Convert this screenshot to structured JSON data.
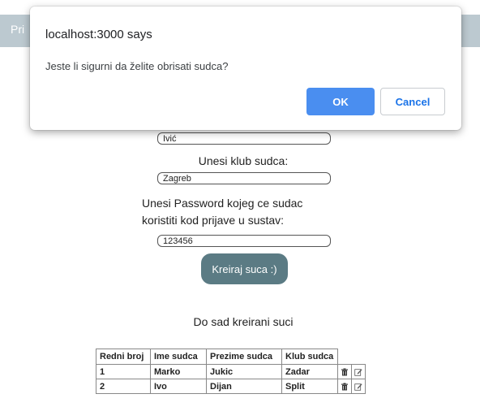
{
  "topbar": {
    "text": "Pri"
  },
  "form": {
    "surname_value": "Ivić",
    "club_label": "Unesi klub sudca:",
    "club_value": "Zagreb",
    "password_label_line1": "Unesi Password kojeg ce sudac",
    "password_label_line2": "koristiti kod prijave u sustav:",
    "password_value": "123456",
    "create_button": "Kreiraj suca :)"
  },
  "judges": {
    "title": "Do sad kreirani suci",
    "headers": [
      "Redni broj",
      "Ime sudca",
      "Prezime sudca",
      "Klub sudca"
    ],
    "rows": [
      {
        "num": "1",
        "name": "Marko",
        "surname": "Jukic",
        "club": "Zadar"
      },
      {
        "num": "2",
        "name": "Ivo",
        "surname": "Dijan",
        "club": "Split"
      }
    ],
    "row_icons": [
      "trash-icon",
      "edit-icon"
    ]
  },
  "dialog": {
    "title": "localhost:3000 says",
    "message": "Jeste li sigurni da želite obrisati sudca?",
    "ok_label": "OK",
    "cancel_label": "Cancel",
    "ok_color": "#4a8ef0",
    "cancel_text_color": "#1a73e8"
  }
}
